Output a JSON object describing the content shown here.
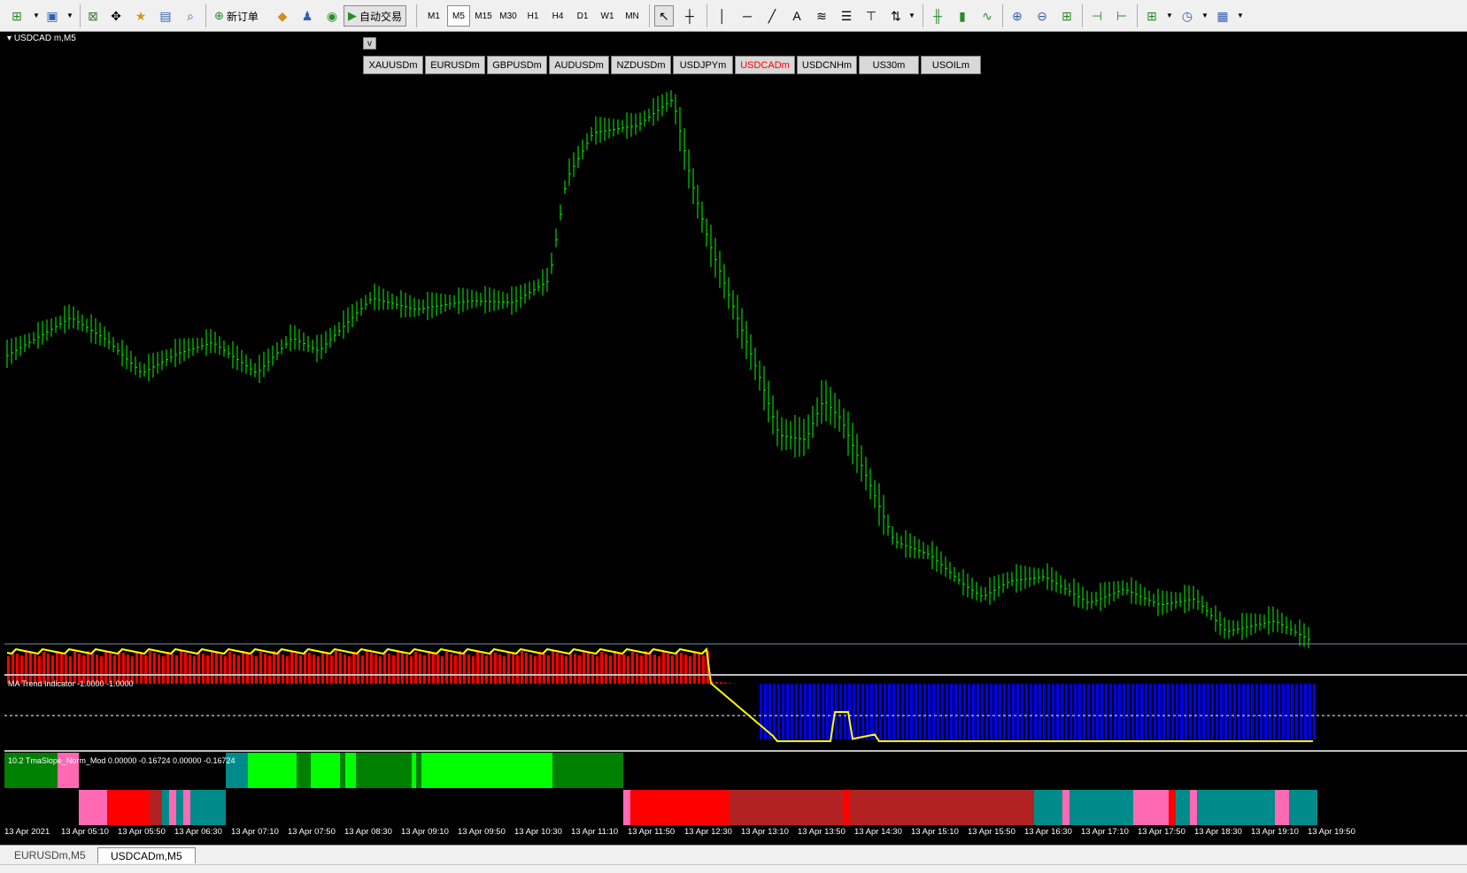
{
  "toolbar": {
    "new_order_label": "新订单",
    "auto_trade_label": "自动交易",
    "timeframes": [
      "M1",
      "M5",
      "M15",
      "M30",
      "H1",
      "H4",
      "D1",
      "W1",
      "MN"
    ],
    "active_timeframe": "M5"
  },
  "chart": {
    "title": "USDCAD m,M5",
    "v_button_label": "v",
    "symbols": [
      "XAUUSDm",
      "EURUSDm",
      "GBPUSDm",
      "AUDUSDm",
      "NZDUSDm",
      "USDJPYm",
      "USDCADm",
      "USDCNHm",
      "US30m",
      "USOILm"
    ],
    "active_symbol": "USDCADm",
    "bar_color": "#00ff00",
    "price_line_color": "#6e8fa8"
  },
  "indicators": {
    "ma_trend_label": "MA Trend Indicator -1.0000 -1.0000",
    "tma_label": "10.2 TmaSlope_Norm_Mod 0.00000 -0.16724 0.00000 -0.16724",
    "colors": {
      "up_histogram": "#ff0000",
      "down_histogram": "#0000ff",
      "line": "#ffff00",
      "lime": "#00ff00",
      "dark_green": "#008000",
      "pink": "#ff69b4",
      "red": "#ff0000",
      "brown": "#b22222",
      "teal": "#008b8b"
    }
  },
  "time_axis": {
    "labels": [
      "13 Apr 2021",
      "13 Apr 05:10",
      "13 Apr 05:50",
      "13 Apr 06:30",
      "13 Apr 07:10",
      "13 Apr 07:50",
      "13 Apr 08:30",
      "13 Apr 09:10",
      "13 Apr 09:50",
      "13 Apr 10:30",
      "13 Apr 11:10",
      "13 Apr 11:50",
      "13 Apr 12:30",
      "13 Apr 13:10",
      "13 Apr 13:50",
      "13 Apr 14:30",
      "13 Apr 15:10",
      "13 Apr 15:50",
      "13 Apr 16:30",
      "13 Apr 17:10",
      "13 Apr 17:50",
      "13 Apr 18:30",
      "13 Apr 19:10",
      "13 Apr 19:50"
    ]
  },
  "tabs": {
    "items": [
      "EURUSDm,M5",
      "USDCADm,M5"
    ],
    "active": "USDCADm,M5"
  }
}
